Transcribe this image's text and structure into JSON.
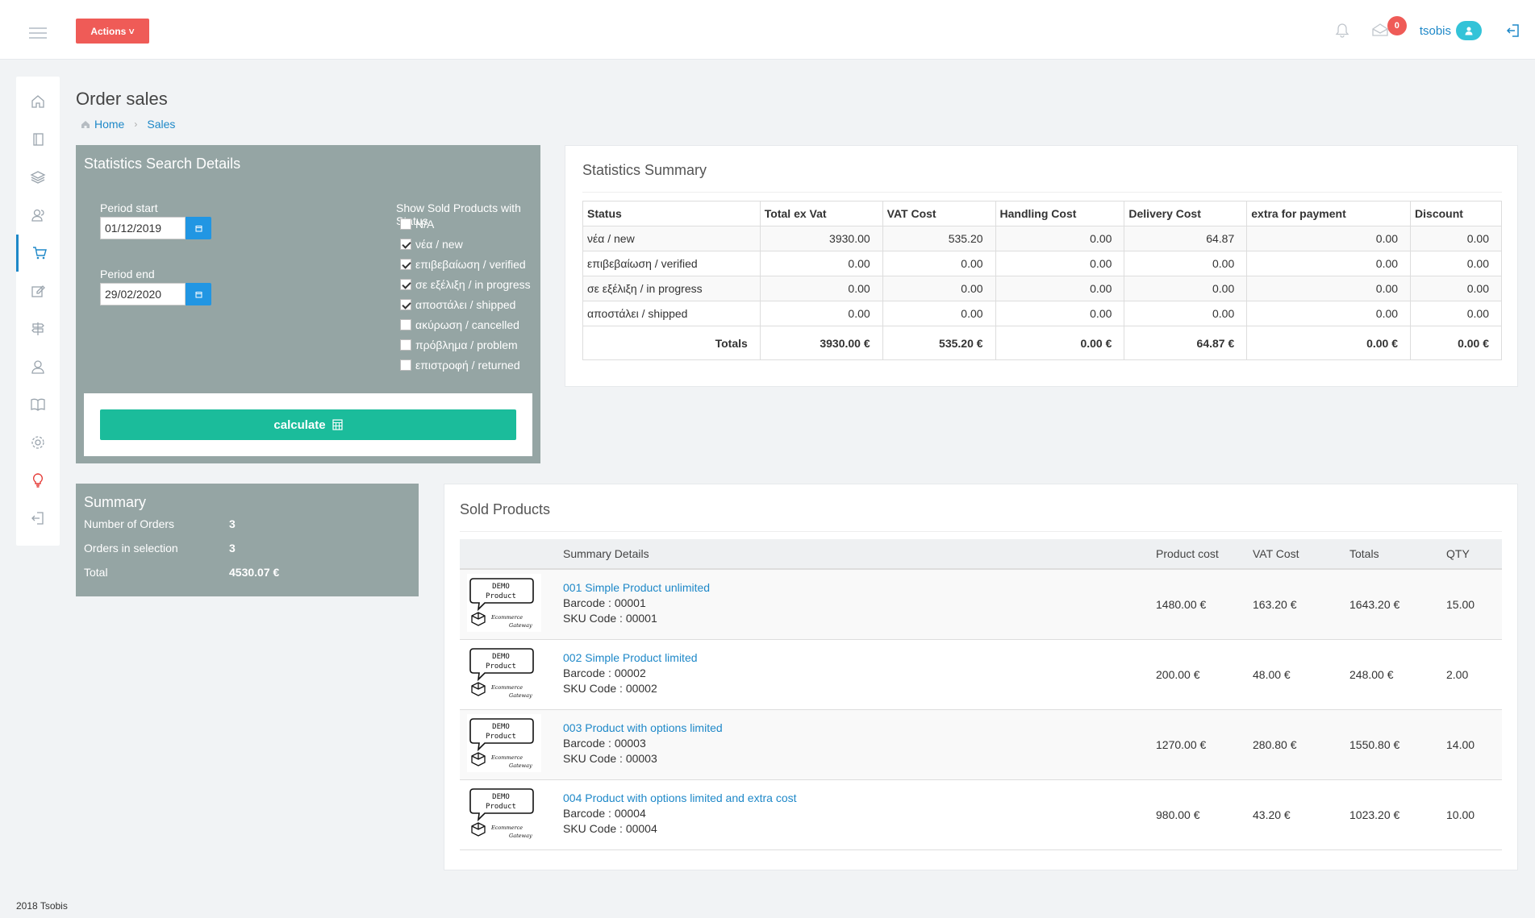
{
  "header": {
    "actions_label": "Actions",
    "mail_count": "0",
    "username": "tsobis"
  },
  "sidebar": {
    "icons": [
      "home-icon",
      "book-icon",
      "layers-icon",
      "users-icon",
      "cart-icon",
      "edit-icon",
      "signpost-icon",
      "user-icon",
      "book-open-icon",
      "gear-icon",
      "lightbulb-icon",
      "logout-icon"
    ],
    "active": "cart-icon"
  },
  "page": {
    "title": "Order sales",
    "breadcrumb": [
      "Home",
      "Sales"
    ]
  },
  "search": {
    "heading": "Statistics Search Details",
    "period_start_label": "Period start",
    "period_start_value": "01/12/2019",
    "period_end_label": "Period end",
    "period_end_value": "29/02/2020",
    "status_label": "Show Sold Products with Status",
    "statuses": [
      {
        "label": "N/A",
        "checked": false
      },
      {
        "label": "νέα / new",
        "checked": true
      },
      {
        "label": "επιβεβαίωση / verified",
        "checked": true
      },
      {
        "label": "σε εξέλιξη / in progress",
        "checked": true
      },
      {
        "label": "αποστάλει / shipped",
        "checked": true
      },
      {
        "label": "ακύρωση / cancelled",
        "checked": false
      },
      {
        "label": "πρόβλημα / problem",
        "checked": false
      },
      {
        "label": "επιστροφή / returned",
        "checked": false
      }
    ],
    "calculate_label": "calculate"
  },
  "summary": {
    "title": "Summary",
    "rows": [
      {
        "label": "Number of Orders",
        "value": "3"
      },
      {
        "label": "Orders in selection",
        "value": "3"
      },
      {
        "label": "Total",
        "value": "4530.07 €"
      }
    ]
  },
  "stats": {
    "heading": "Statistics Summary",
    "columns": [
      "Status",
      "Total ex Vat",
      "VAT Cost",
      "Handling Cost",
      "Delivery Cost",
      "extra for payment",
      "Discount"
    ],
    "rows": [
      [
        "νέα / new",
        "3930.00",
        "535.20",
        "0.00",
        "64.87",
        "0.00",
        "0.00"
      ],
      [
        "επιβεβαίωση / verified",
        "0.00",
        "0.00",
        "0.00",
        "0.00",
        "0.00",
        "0.00"
      ],
      [
        "σε εξέλιξη / in progress",
        "0.00",
        "0.00",
        "0.00",
        "0.00",
        "0.00",
        "0.00"
      ],
      [
        "αποστάλει / shipped",
        "0.00",
        "0.00",
        "0.00",
        "0.00",
        "0.00",
        "0.00"
      ]
    ],
    "totals": [
      "Totals",
      "3930.00 €",
      "535.20 €",
      "0.00 €",
      "64.87 €",
      "0.00 €",
      "0.00 €"
    ]
  },
  "products": {
    "heading": "Sold Products",
    "columns": [
      "",
      "Summary Details",
      "Product cost",
      "VAT Cost",
      "Totals",
      "QTY"
    ],
    "thumb_text": [
      "DEMO",
      "Product",
      "Ecommerce",
      "Gateway"
    ],
    "items": [
      {
        "name": "001 Simple Product unlimited",
        "barcode": "Barcode : 00001",
        "sku": "SKU Code : 00001",
        "cost": "1480.00 €",
        "vat": "163.20 €",
        "total": "1643.20 €",
        "qty": "15.00"
      },
      {
        "name": "002 Simple Product limited",
        "barcode": "Barcode : 00002",
        "sku": "SKU Code : 00002",
        "cost": "200.00 €",
        "vat": "48.00 €",
        "total": "248.00 €",
        "qty": "2.00"
      },
      {
        "name": "003 Product with options limited",
        "barcode": "Barcode : 00003",
        "sku": "SKU Code : 00003",
        "cost": "1270.00 €",
        "vat": "280.80 €",
        "total": "1550.80 €",
        "qty": "14.00"
      },
      {
        "name": "004 Product with options limited and extra cost",
        "barcode": "Barcode : 00004",
        "sku": "SKU Code : 00004",
        "cost": "980.00 €",
        "vat": "43.20 €",
        "total": "1023.20 €",
        "qty": "10.00"
      }
    ]
  },
  "footer": {
    "text": "2018 Tsobis"
  }
}
